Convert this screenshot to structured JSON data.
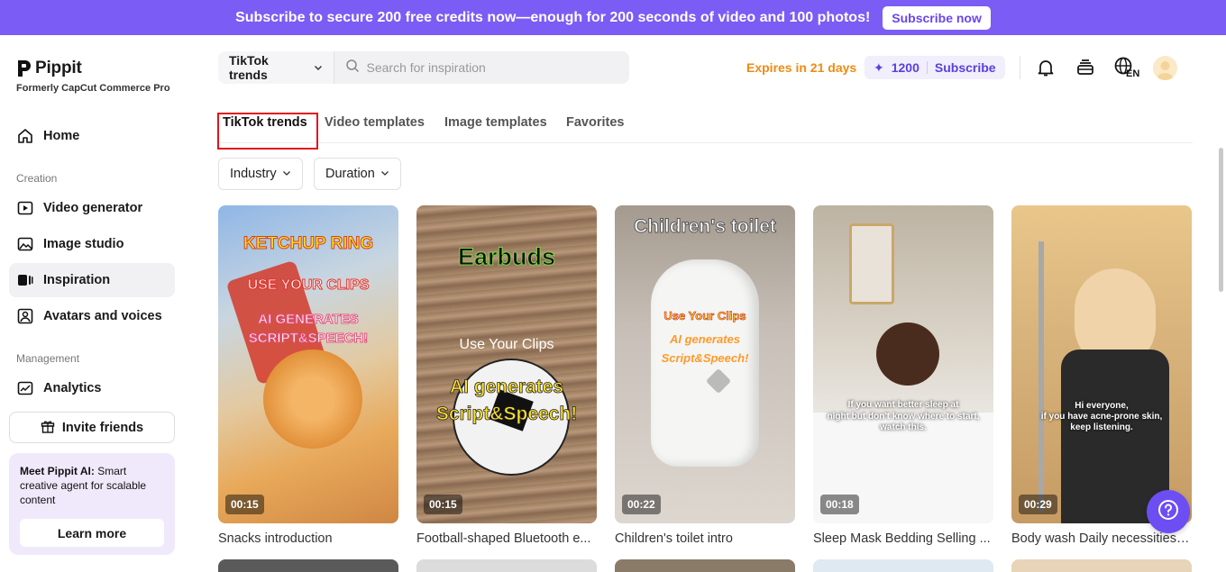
{
  "banner": {
    "text": "Subscribe to secure 200 free credits now—enough for 200 seconds of video and 100 photos!",
    "button": "Subscribe now"
  },
  "brand": {
    "name": "Pippit",
    "subtitle": "Formerly CapCut Commerce Pro"
  },
  "sidebar": {
    "home": "Home",
    "creation_label": "Creation",
    "items": [
      {
        "label": "Video generator",
        "icon": "video-add-icon"
      },
      {
        "label": "Image studio",
        "icon": "image-add-icon"
      },
      {
        "label": "Inspiration",
        "icon": "inspiration-icon"
      },
      {
        "label": "Avatars and voices",
        "icon": "avatar-icon"
      }
    ],
    "management_label": "Management",
    "analytics": "Analytics",
    "invite": "Invite friends",
    "promo": {
      "bold": "Meet Pippit AI:",
      "text": " Smart creative agent for scalable content",
      "button": "Learn more"
    }
  },
  "search": {
    "category": "TikTok trends",
    "placeholder": "Search for inspiration"
  },
  "header": {
    "expires": "Expires in 21 days",
    "credits": "1200",
    "subscribe": "Subscribe",
    "lang": "EN"
  },
  "tabs": [
    "TikTok trends",
    "Video templates",
    "Image templates",
    "Favorites"
  ],
  "filters": [
    "Industry",
    "Duration"
  ],
  "cards": [
    {
      "title": "Snacks introduction",
      "duration": "00:15",
      "overlay": [
        "KETCHUP RING",
        "USE YOUR CLIPS",
        "AI GENERATES",
        "SCRIPT&SPEECH!"
      ]
    },
    {
      "title": "Football-shaped Bluetooth e...",
      "duration": "00:15",
      "overlay": [
        "Earbuds",
        "Use Your Clips",
        "AI generates",
        "Script&Speech!"
      ]
    },
    {
      "title": "Children's toilet intro",
      "duration": "00:22",
      "overlay": [
        "Children's toilet",
        "Use Your Clips",
        "AI generates",
        "Script&Speech!"
      ]
    },
    {
      "title": "Sleep Mask Bedding Selling ...",
      "duration": "00:18",
      "overlay": [
        "If you want better sleep at",
        "night but don't know where to start,",
        "watch this."
      ]
    },
    {
      "title": "Body wash Daily necessities ...",
      "duration": "00:29",
      "overlay": [
        "Hi everyone,",
        "if you have acne-prone skin,",
        "keep listening."
      ]
    }
  ]
}
